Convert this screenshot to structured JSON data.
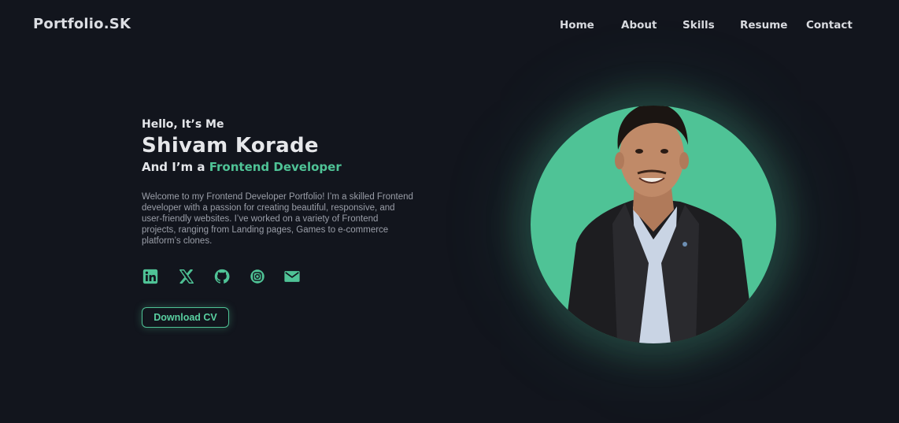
{
  "header": {
    "logo": "Portfolio.SK",
    "nav": [
      {
        "label": "Home"
      },
      {
        "label": "About"
      },
      {
        "label": "Skills"
      },
      {
        "label": "Resume"
      },
      {
        "label": "Contact"
      }
    ]
  },
  "hero": {
    "greeting": "Hello, It’s Me",
    "name": "Shivam Korade",
    "role_prefix": "And I’m a ",
    "role_highlight": "Frontend Developer",
    "description": "Welcome to my Frontend Developer Portfolio! I’m a skilled Frontend developer with a passion for creating beautiful, responsive, and user-friendly websites. I’ve worked on a variety of Frontend projects, ranging from Landing pages, Games to e-commerce platform’s clones.",
    "cv_button": "Download CV"
  },
  "socials": [
    {
      "icon": "linkedin-icon"
    },
    {
      "icon": "x-twitter-icon"
    },
    {
      "icon": "github-icon"
    },
    {
      "icon": "instagram-icon"
    },
    {
      "icon": "mail-icon"
    }
  ],
  "colors": {
    "background": "#12151d",
    "accent": "#4fc396",
    "text": "#e4e6ea",
    "muted": "#9a9ea8"
  }
}
